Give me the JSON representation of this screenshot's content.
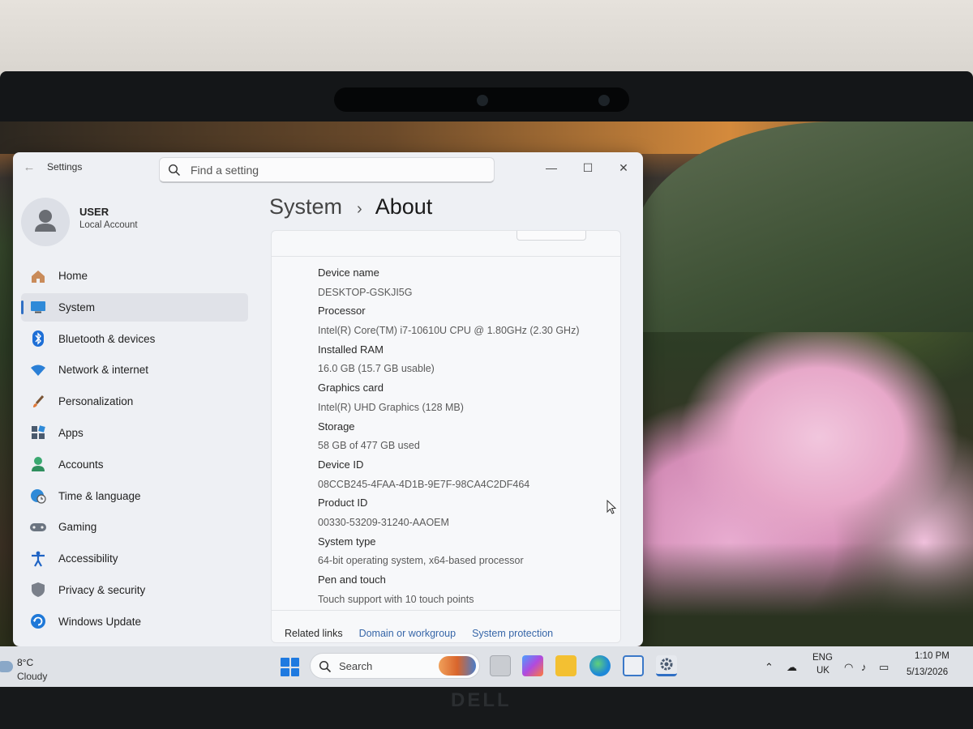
{
  "window": {
    "app_title": "Settings",
    "search_placeholder": "Find a setting",
    "back": "←",
    "minimize": "—",
    "maximize": "☐",
    "close": "✕"
  },
  "user": {
    "name": "USER",
    "account_type": "Local Account"
  },
  "sidebar": {
    "items": [
      {
        "label": "Home",
        "icon": "home-icon"
      },
      {
        "label": "System",
        "icon": "system-icon",
        "active": true
      },
      {
        "label": "Bluetooth & devices",
        "icon": "bluetooth-icon"
      },
      {
        "label": "Network & internet",
        "icon": "wifi-icon"
      },
      {
        "label": "Personalization",
        "icon": "brush-icon"
      },
      {
        "label": "Apps",
        "icon": "apps-icon"
      },
      {
        "label": "Accounts",
        "icon": "accounts-icon"
      },
      {
        "label": "Time & language",
        "icon": "globe-clock-icon"
      },
      {
        "label": "Gaming",
        "icon": "gamepad-icon"
      },
      {
        "label": "Accessibility",
        "icon": "accessibility-icon"
      },
      {
        "label": "Privacy & security",
        "icon": "shield-icon"
      },
      {
        "label": "Windows Update",
        "icon": "update-icon"
      }
    ]
  },
  "breadcrumb": {
    "parent": "System",
    "separator": "›",
    "current": "About"
  },
  "device_specs": [
    {
      "label": "Device name",
      "value": "DESKTOP-GSKJI5G"
    },
    {
      "label": "Processor",
      "value": "Intel(R) Core(TM) i7-10610U CPU @ 1.80GHz (2.30 GHz)"
    },
    {
      "label": "Installed RAM",
      "value": "16.0 GB (15.7 GB usable)"
    },
    {
      "label": "Graphics card",
      "value": "Intel(R) UHD Graphics (128 MB)"
    },
    {
      "label": "Storage",
      "value": "58 GB of 477 GB used"
    },
    {
      "label": "Device ID",
      "value": "08CCB245-4FAA-4D1B-9E7F-98CA4C2DF464"
    },
    {
      "label": "Product ID",
      "value": "00330-53209-31240-AAOEM"
    },
    {
      "label": "System type",
      "value": "64-bit operating system, x64-based processor"
    },
    {
      "label": "Pen and touch",
      "value": "Touch support with 10 touch points"
    }
  ],
  "related_links": {
    "label": "Related links",
    "links": [
      "Domain or workgroup",
      "System protection"
    ]
  },
  "taskbar": {
    "weather_temp": "8°C",
    "weather_condition": "Cloudy",
    "search_label": "Search",
    "lang_line1": "ENG",
    "lang_line2": "UK",
    "time": "1:10 PM",
    "date": "5/13/2026"
  },
  "hardware": {
    "brand": "DELL"
  },
  "colors": {
    "accent": "#2f6fc4",
    "window_bg": "#eef0f4",
    "taskbar_bg": "#dfe2e7"
  }
}
